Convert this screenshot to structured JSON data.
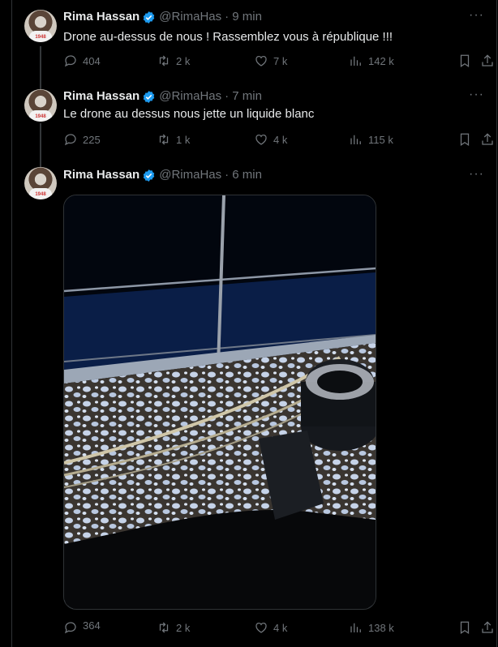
{
  "tweets": [
    {
      "name": "Rima Hassan",
      "handle": "@RimaHas",
      "time": "· 9 min",
      "text": "Drone au-dessus de nous ! Rassemblez vous à république !!!",
      "stats": {
        "replies": "404",
        "retweets": "2 k",
        "likes": "7 k",
        "views": "142 k"
      }
    },
    {
      "name": "Rima Hassan",
      "handle": "@RimaHas",
      "time": "· 7 min",
      "text": "Le drone au dessus nous jette un liquide blanc",
      "stats": {
        "replies": "225",
        "retweets": "1 k",
        "likes": "4 k",
        "views": "115 k"
      }
    },
    {
      "name": "Rima Hassan",
      "handle": "@RimaHas",
      "time": "· 6 min",
      "text": "",
      "stats": {
        "replies": "364",
        "retweets": "2 k",
        "likes": "4 k",
        "views": "138 k"
      }
    }
  ],
  "avatar_label": "1948",
  "icons": [
    "more-icon",
    "verified-badge-icon",
    "reply-icon",
    "retweet-icon",
    "like-icon",
    "views-icon",
    "bookmark-icon",
    "share-icon"
  ],
  "colors": {
    "background": "#000000",
    "verified": "#1d9bf0",
    "muted": "#71767b",
    "text": "#e7e9ea"
  }
}
